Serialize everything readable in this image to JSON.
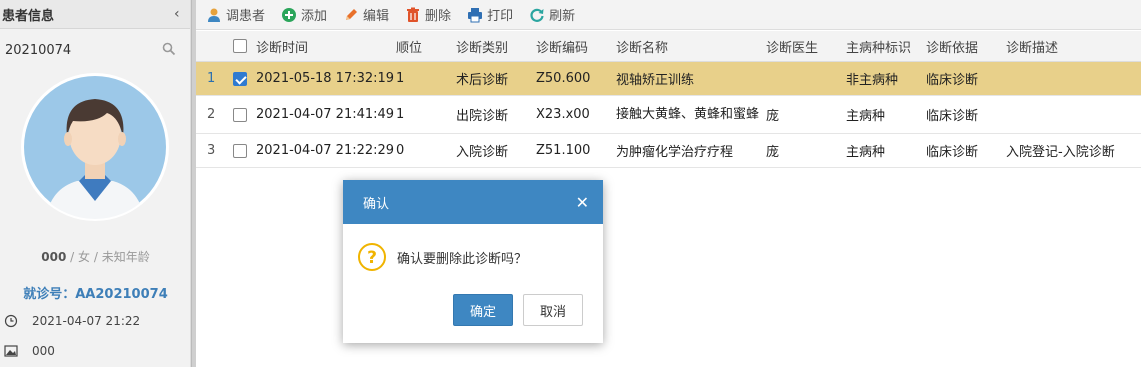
{
  "left_panel": {
    "title": "患者信息",
    "search_value": "20210074",
    "patient_name": "000",
    "patient_meta_rest": " / 女 / 未知年龄",
    "visit_number": "就诊号：AA20210074",
    "visit_time": "2021-04-07 21:22",
    "extra_value": "000"
  },
  "toolbar": {
    "buttons": [
      {
        "label": "调患者",
        "icon": "user-icon"
      },
      {
        "label": "添加",
        "icon": "add-icon"
      },
      {
        "label": "编辑",
        "icon": "edit-pencil-icon"
      },
      {
        "label": "删除",
        "icon": "trash-icon"
      },
      {
        "label": "打印",
        "icon": "print-icon"
      },
      {
        "label": "刷新",
        "icon": "refresh-icon"
      }
    ]
  },
  "grid": {
    "columns": [
      "诊断时间",
      "顺位",
      "诊断类别",
      "诊断编码",
      "诊断名称",
      "诊断医生",
      "主病种标识",
      "诊断依据",
      "诊断描述"
    ],
    "rows": [
      {
        "num": "1",
        "checked": true,
        "time": "2021-05-18 17:32:19",
        "order": "1",
        "type": "术后诊断",
        "code": "Z50.600",
        "name": "视轴矫正训练",
        "doctor": "",
        "flag": "非主病种",
        "basis": "临床诊断",
        "desc": ""
      },
      {
        "num": "2",
        "checked": false,
        "time": "2021-04-07 21:41:49",
        "order": "1",
        "type": "出院诊断",
        "code": "X23.x00",
        "name": "接触大黄蜂、黄蜂和蜜蜂",
        "doctor": "庞",
        "flag": "主病种",
        "basis": "临床诊断",
        "desc": ""
      },
      {
        "num": "3",
        "checked": false,
        "time": "2021-04-07 21:22:29",
        "order": "0",
        "type": "入院诊断",
        "code": "Z51.100",
        "name": "为肿瘤化学治疗疗程",
        "doctor": "庞",
        "flag": "主病种",
        "basis": "临床诊断",
        "desc": "入院登记-入院诊断"
      }
    ]
  },
  "dialog": {
    "title": "确认",
    "message": "确认要删除此诊断吗？",
    "ok_label": "确定",
    "cancel_label": "取消"
  },
  "colors": {
    "accent": "#3e87c2",
    "selected_row": "#e8d08a",
    "visit_number": "#3e7fb8"
  }
}
